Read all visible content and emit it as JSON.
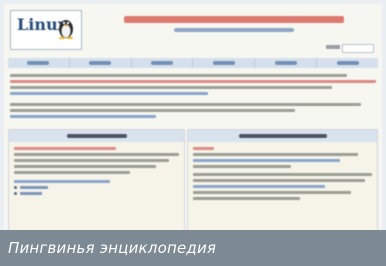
{
  "caption": {
    "text": "Пингвинья энциклопедия"
  },
  "site": {
    "logo": {
      "text": "Linux",
      "icon": "penguin-icon"
    }
  },
  "colors": {
    "caption_bg": "#7d8a94",
    "nav_bg": "#d5e0ec",
    "header_red": "#de7a72",
    "link_blue": "#8aa6cc"
  }
}
